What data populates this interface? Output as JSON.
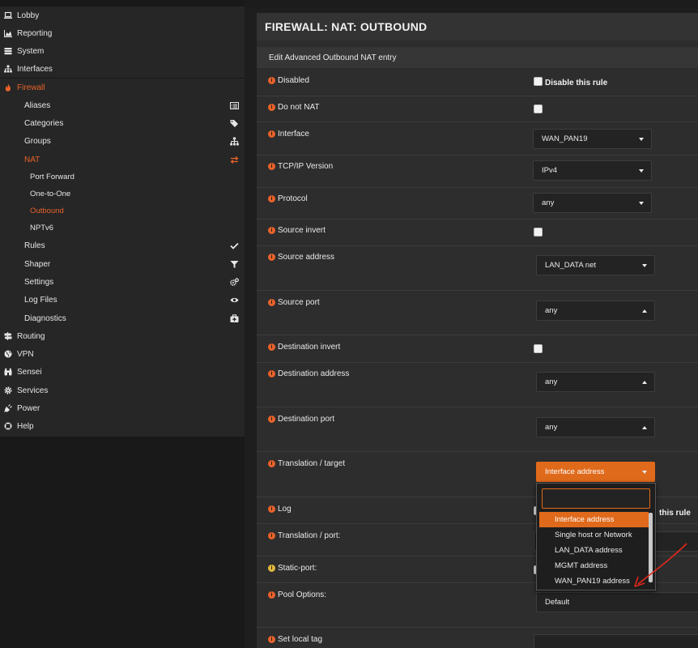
{
  "sidebar": {
    "items": [
      {
        "label": "Lobby",
        "icon": "laptop-icon"
      },
      {
        "label": "Reporting",
        "icon": "area-chart-icon"
      },
      {
        "label": "System",
        "icon": "server-icon"
      },
      {
        "label": "Interfaces",
        "icon": "sitemap-icon"
      },
      {
        "label": "Firewall",
        "icon": "fire-icon"
      }
    ],
    "firewall_sub": [
      {
        "label": "Aliases",
        "icon": "list-alt-icon"
      },
      {
        "label": "Categories",
        "icon": "tags-icon"
      },
      {
        "label": "Groups",
        "icon": "sitemap-icon"
      },
      {
        "label": "NAT",
        "icon": "exchange-icon"
      },
      {
        "label": "Rules",
        "icon": "check-icon"
      },
      {
        "label": "Shaper",
        "icon": "filter-icon"
      },
      {
        "label": "Settings",
        "icon": "cogs-icon"
      },
      {
        "label": "Log Files",
        "icon": "eye-icon"
      },
      {
        "label": "Diagnostics",
        "icon": "medkit-icon"
      }
    ],
    "nat_sub": [
      "Port Forward",
      "One-to-One",
      "Outbound",
      "NPTv6"
    ],
    "bottom_items": [
      {
        "label": "Routing",
        "icon": "signs-icon"
      },
      {
        "label": "VPN",
        "icon": "globe-icon"
      },
      {
        "label": "Sensei",
        "icon": "binoculars-icon"
      },
      {
        "label": "Services",
        "icon": "cog-icon"
      },
      {
        "label": "Power",
        "icon": "plug-icon"
      },
      {
        "label": "Help",
        "icon": "life-ring-icon"
      }
    ]
  },
  "page": {
    "title": "FIREWALL: NAT: OUTBOUND",
    "subheader": "Edit Advanced Outbound NAT entry"
  },
  "form": {
    "disabled": {
      "label": "Disabled",
      "checkbox_label": "Disable this rule"
    },
    "do_not_nat": {
      "label": "Do not NAT"
    },
    "interface": {
      "label": "Interface",
      "value": "WAN_PAN19"
    },
    "tcpip_version": {
      "label": "TCP/IP Version",
      "value": "IPv4"
    },
    "protocol": {
      "label": "Protocol",
      "value": "any"
    },
    "source_invert": {
      "label": "Source invert"
    },
    "source_address": {
      "label": "Source address",
      "value": "LAN_DATA net"
    },
    "source_port": {
      "label": "Source port",
      "value": "any"
    },
    "destination_invert": {
      "label": "Destination invert"
    },
    "destination_address": {
      "label": "Destination address",
      "value": "any"
    },
    "destination_port": {
      "label": "Destination port",
      "value": "any"
    },
    "translation_target": {
      "label": "Translation / target",
      "value": "Interface address"
    },
    "log": {
      "label": "Log",
      "checkbox_label_partial": "this rule"
    },
    "translation_port": {
      "label": "Translation / port:"
    },
    "static_port": {
      "label": "Static-port:"
    },
    "pool_options": {
      "label": "Pool Options:",
      "value": "Default"
    },
    "set_local_tag": {
      "label": "Set local tag"
    }
  },
  "dropdown": {
    "search_placeholder": "",
    "options": [
      "Interface address",
      "Single host or Network",
      "LAN_DATA address",
      "MGMT address",
      "WAN_PAN19 address"
    ],
    "selected_index": 0
  },
  "colors": {
    "accent": "#e06a1b",
    "sidebar_bg": "#262626",
    "main_bg": "#2d2d2d",
    "annotation_arrow": "#e0281d"
  }
}
